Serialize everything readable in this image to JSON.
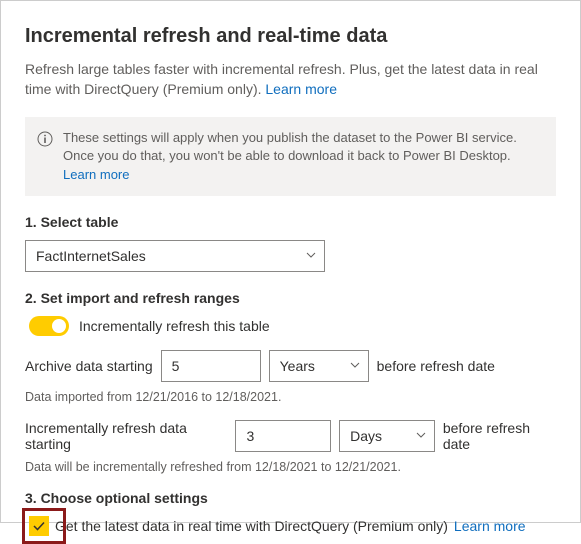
{
  "header": {
    "title": "Incremental refresh and real-time data",
    "subtitle_a": "Refresh large tables faster with incremental refresh. Plus, get the latest data in real time with DirectQuery (Premium only). ",
    "learn_more": "Learn more"
  },
  "infobar": {
    "text": "These settings will apply when you publish the dataset to the Power BI service. Once you do that, you won't be able to download it back to Power BI Desktop. ",
    "learn_more": "Learn more"
  },
  "section1": {
    "label": "1. Select table",
    "selected": "FactInternetSales"
  },
  "section2": {
    "label": "2. Set import and refresh ranges",
    "toggle_label": "Incrementally refresh this table",
    "archive_before": "Archive data starting",
    "archive_value": "5",
    "archive_unit": "Years",
    "archive_after": "before refresh date",
    "archive_hint": "Data imported from 12/21/2016 to 12/18/2021.",
    "refresh_before": "Incrementally refresh data starting",
    "refresh_value": "3",
    "refresh_unit": "Days",
    "refresh_after": "before refresh date",
    "refresh_hint": "Data will be incrementally refreshed from 12/18/2021 to 12/21/2021."
  },
  "section3": {
    "label": "3. Choose optional settings",
    "opt1_label": "Get the latest data in real time with DirectQuery (Premium only)",
    "opt1_learn": "Learn more"
  }
}
